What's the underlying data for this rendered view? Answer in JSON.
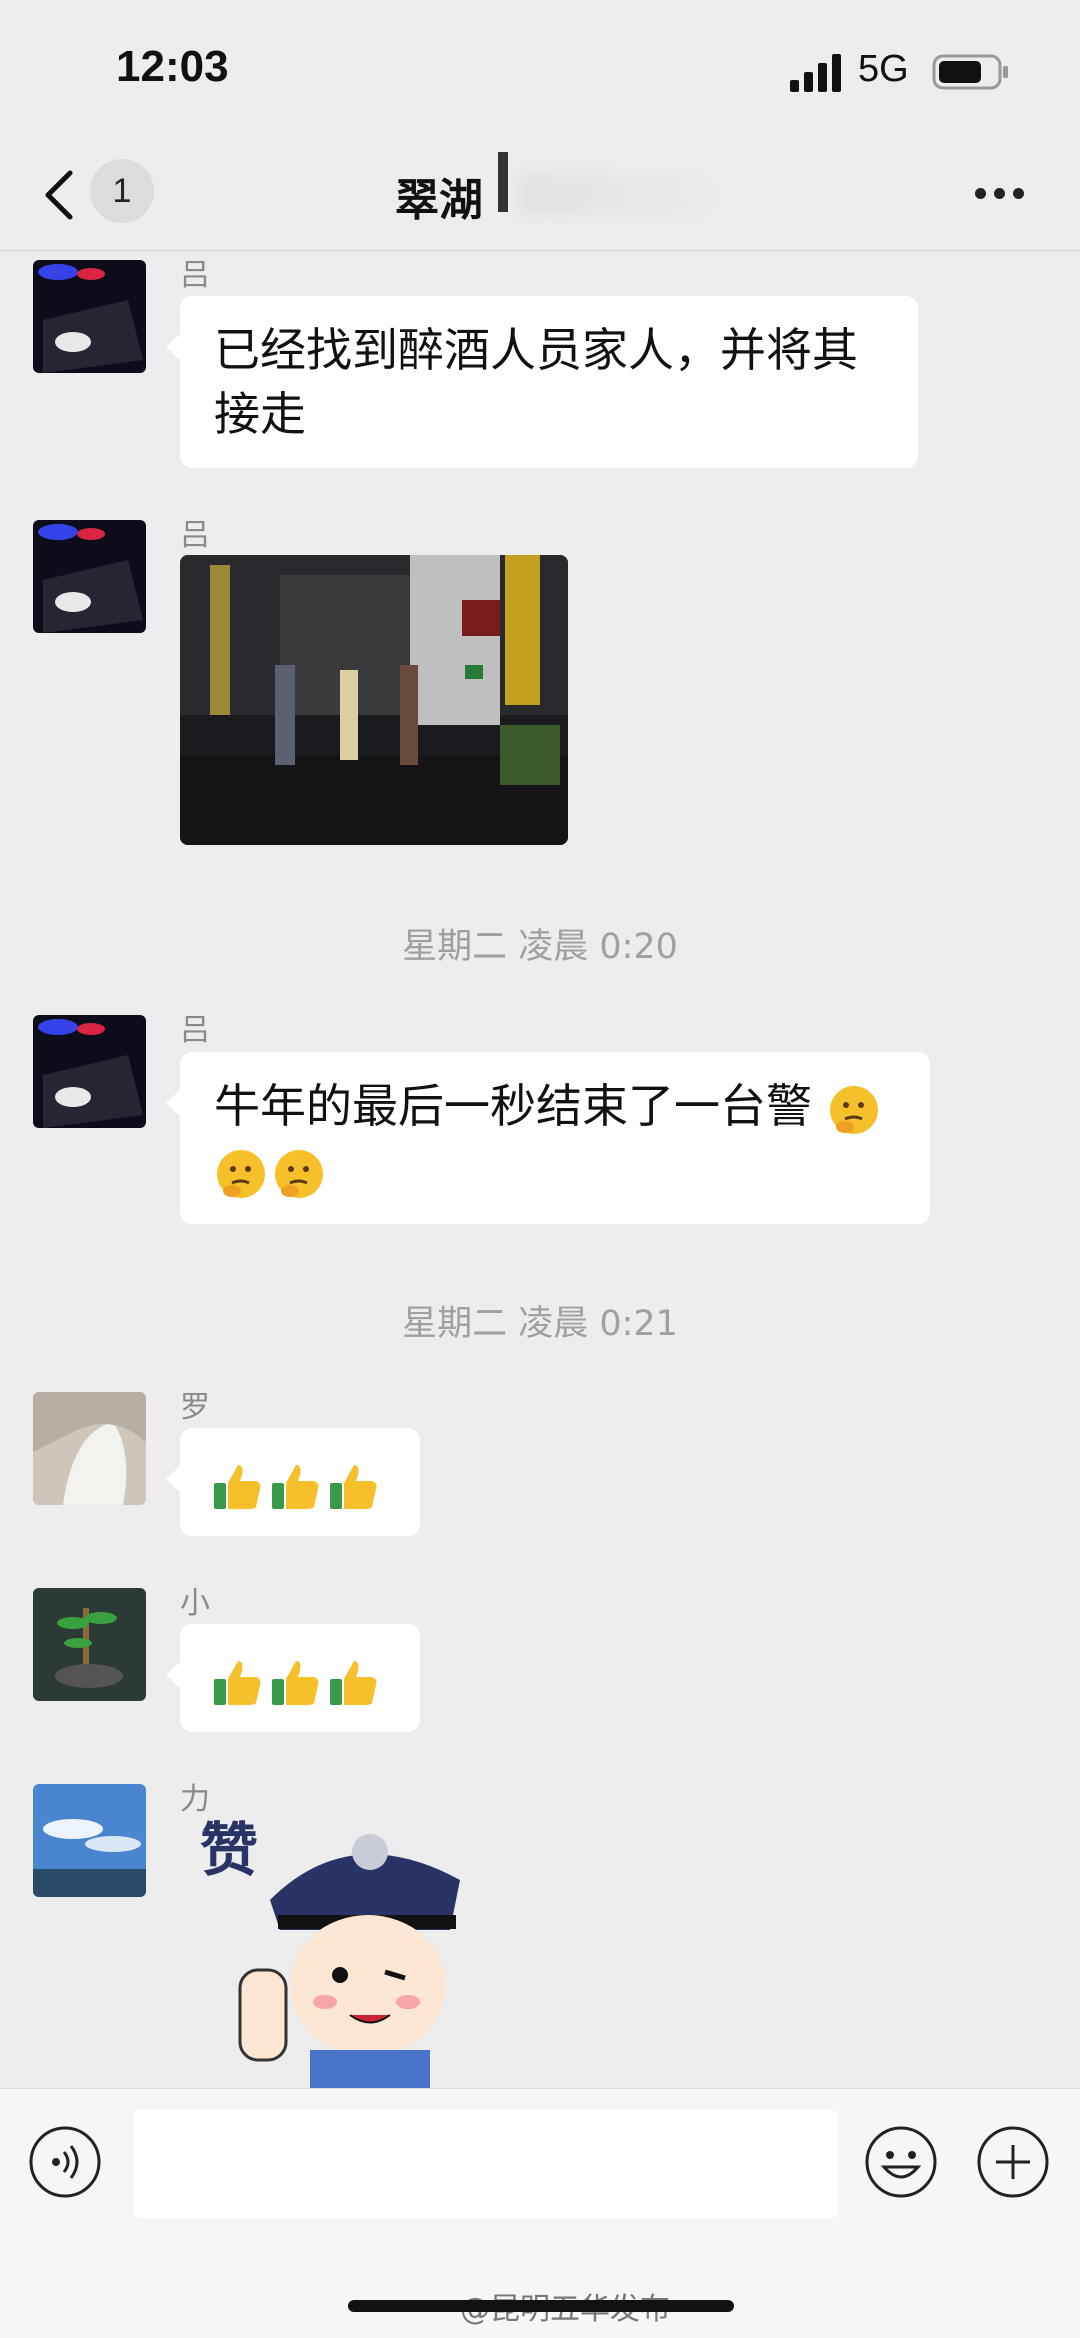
{
  "status_bar": {
    "time": "12:03",
    "network": "5G"
  },
  "header": {
    "unread_count": "1",
    "title": "翠湖"
  },
  "messages": [
    {
      "sender": "吕",
      "text_line1": "已经找到醉酒人员家人，并将其",
      "text_line2": "接走"
    },
    {
      "sender": "吕"
    },
    {
      "timestamp": "星期二 凌晨 0:20"
    },
    {
      "sender": "吕",
      "text": "牛年的最后一秒结束了一台警"
    },
    {
      "timestamp": "星期二 凌晨 0:21"
    },
    {
      "sender": "罗"
    },
    {
      "sender": "小"
    },
    {
      "sender": "力"
    }
  ],
  "sticker": {
    "text": "赞"
  },
  "watermark": "@昆明五华发布",
  "icons": [
    "back-icon",
    "more-icon",
    "voice-icon",
    "emoji-icon",
    "plus-icon",
    "thumbs-up-icon",
    "thinking-face-icon"
  ]
}
